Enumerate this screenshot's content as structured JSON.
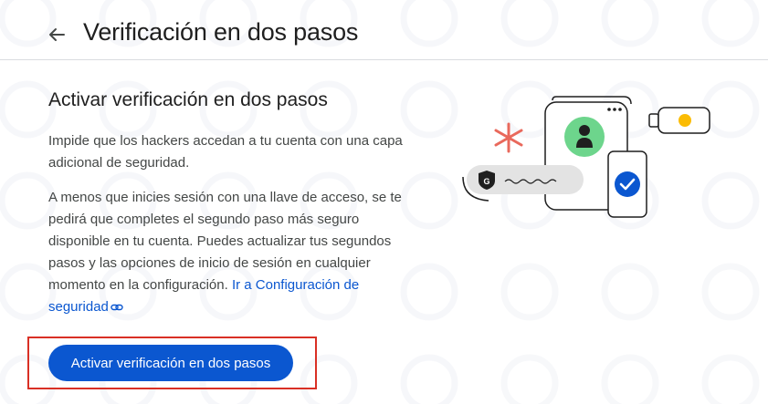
{
  "header": {
    "back_icon": "arrow-back-icon",
    "title": "Verificación en dos pasos"
  },
  "card": {
    "title": "Activar verificación en dos pasos",
    "paragraph1": "Impide que los hackers accedan a tu cuenta con una capa adicional de seguridad.",
    "paragraph2": "A menos que inicies sesión con una llave de acceso, se te pedirá que completes el segundo paso más seguro disponible en tu cuenta. Puedes actualizar tus segundos pasos y las opciones de inicio de sesión en cualquier momento en la configuración.",
    "link_text": "Ir a Configuración de seguridad",
    "link_icon": "link-icon",
    "button_label": "Activar verificación en dos pasos"
  },
  "illustration": {
    "badge_letter": "G"
  },
  "colors": {
    "primary": "#0b57d0",
    "highlight": "#d93025",
    "badge_green": "#6dd58c",
    "asterisk_red": "#e9695c",
    "key_yellow": "#fbbc04"
  }
}
